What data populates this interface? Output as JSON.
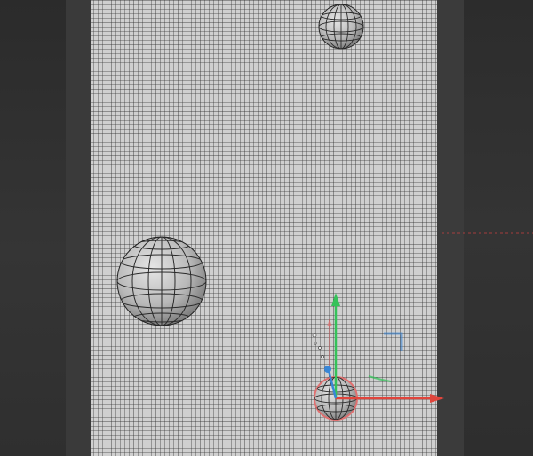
{
  "viewport": {
    "title": "",
    "mesh_color": "#c9c9c9",
    "wire_color": "#2a2a2a",
    "axis_x_color": "#e0453c",
    "axis_y_color": "#35c25a",
    "axis_z_color": "#3a86d6",
    "selection_color": "#e07070"
  },
  "objects": [
    {
      "name": "sphere-top"
    },
    {
      "name": "sphere-left"
    },
    {
      "name": "sphere-selected"
    }
  ],
  "gizmo": {
    "icon": "move-gizmo-icon"
  }
}
